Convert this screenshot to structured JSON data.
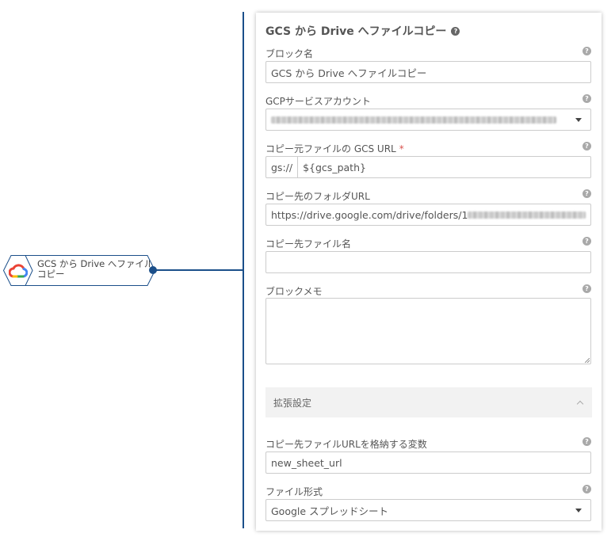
{
  "canvas": {
    "node": {
      "label_line1": "GCS から Drive へファイル",
      "label_line2": "コピー",
      "icon": "google-cloud-icon"
    },
    "colors": {
      "connector": "#1b4f8a"
    }
  },
  "panel": {
    "title": "GCS から Drive へファイルコピー",
    "help_glyph": "?",
    "fields": {
      "block_name": {
        "label": "ブロック名",
        "value": "GCS から Drive へファイルコピー"
      },
      "gcp_account": {
        "label": "GCPサービスアカウント",
        "value": ""
      },
      "gcs_url": {
        "label": "コピー元ファイルの GCS URL",
        "required_mark": "*",
        "prefix": "gs://",
        "value": "${gcs_path}"
      },
      "folder_url": {
        "label": "コピー先のフォルダURL",
        "value": "https://drive.google.com/drive/folders/1"
      },
      "file_name": {
        "label": "コピー先ファイル名",
        "value": ""
      },
      "memo": {
        "label": "ブロックメモ",
        "value": ""
      }
    },
    "advanced": {
      "title": "拡張設定",
      "fields": {
        "url_variable": {
          "label": "コピー先ファイルURLを格納する変数",
          "value": "new_sheet_url"
        },
        "file_format": {
          "label": "ファイル形式",
          "value": "Google スプレッドシート"
        }
      }
    }
  }
}
